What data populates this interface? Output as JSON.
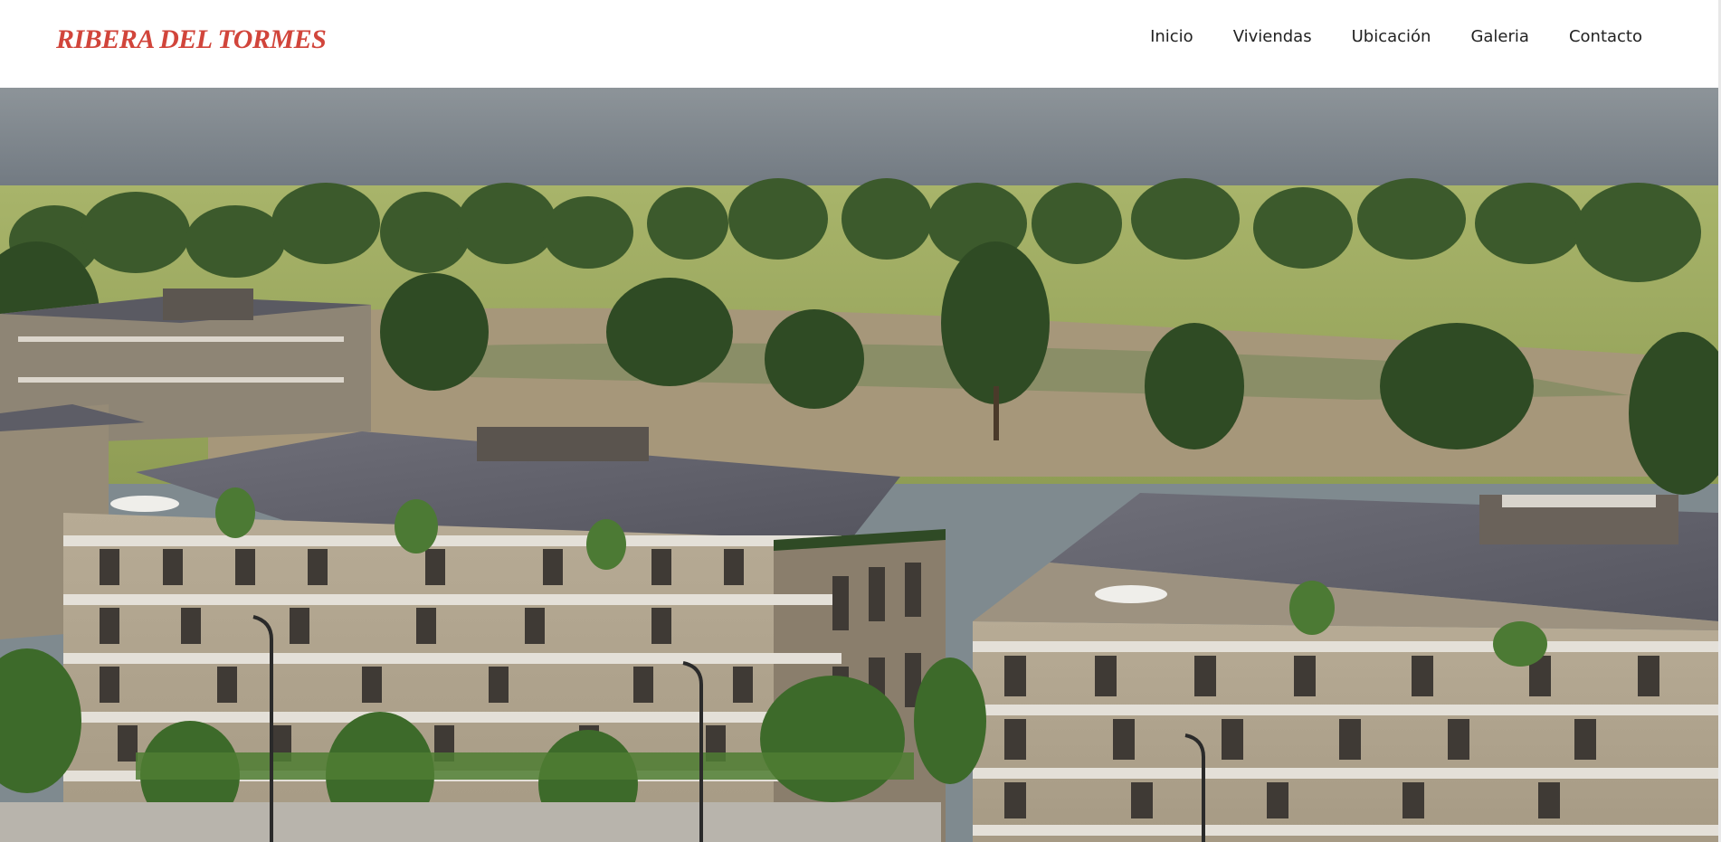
{
  "header": {
    "logo_text": "RIBERA DEL TORMES",
    "nav": [
      {
        "label": "Inicio"
      },
      {
        "label": "Viviendas"
      },
      {
        "label": "Ubicación"
      },
      {
        "label": "Galeria"
      },
      {
        "label": "Contacto"
      }
    ]
  },
  "colors": {
    "brand": "#d1453b",
    "nav_text": "#222222",
    "background": "#ffffff"
  }
}
